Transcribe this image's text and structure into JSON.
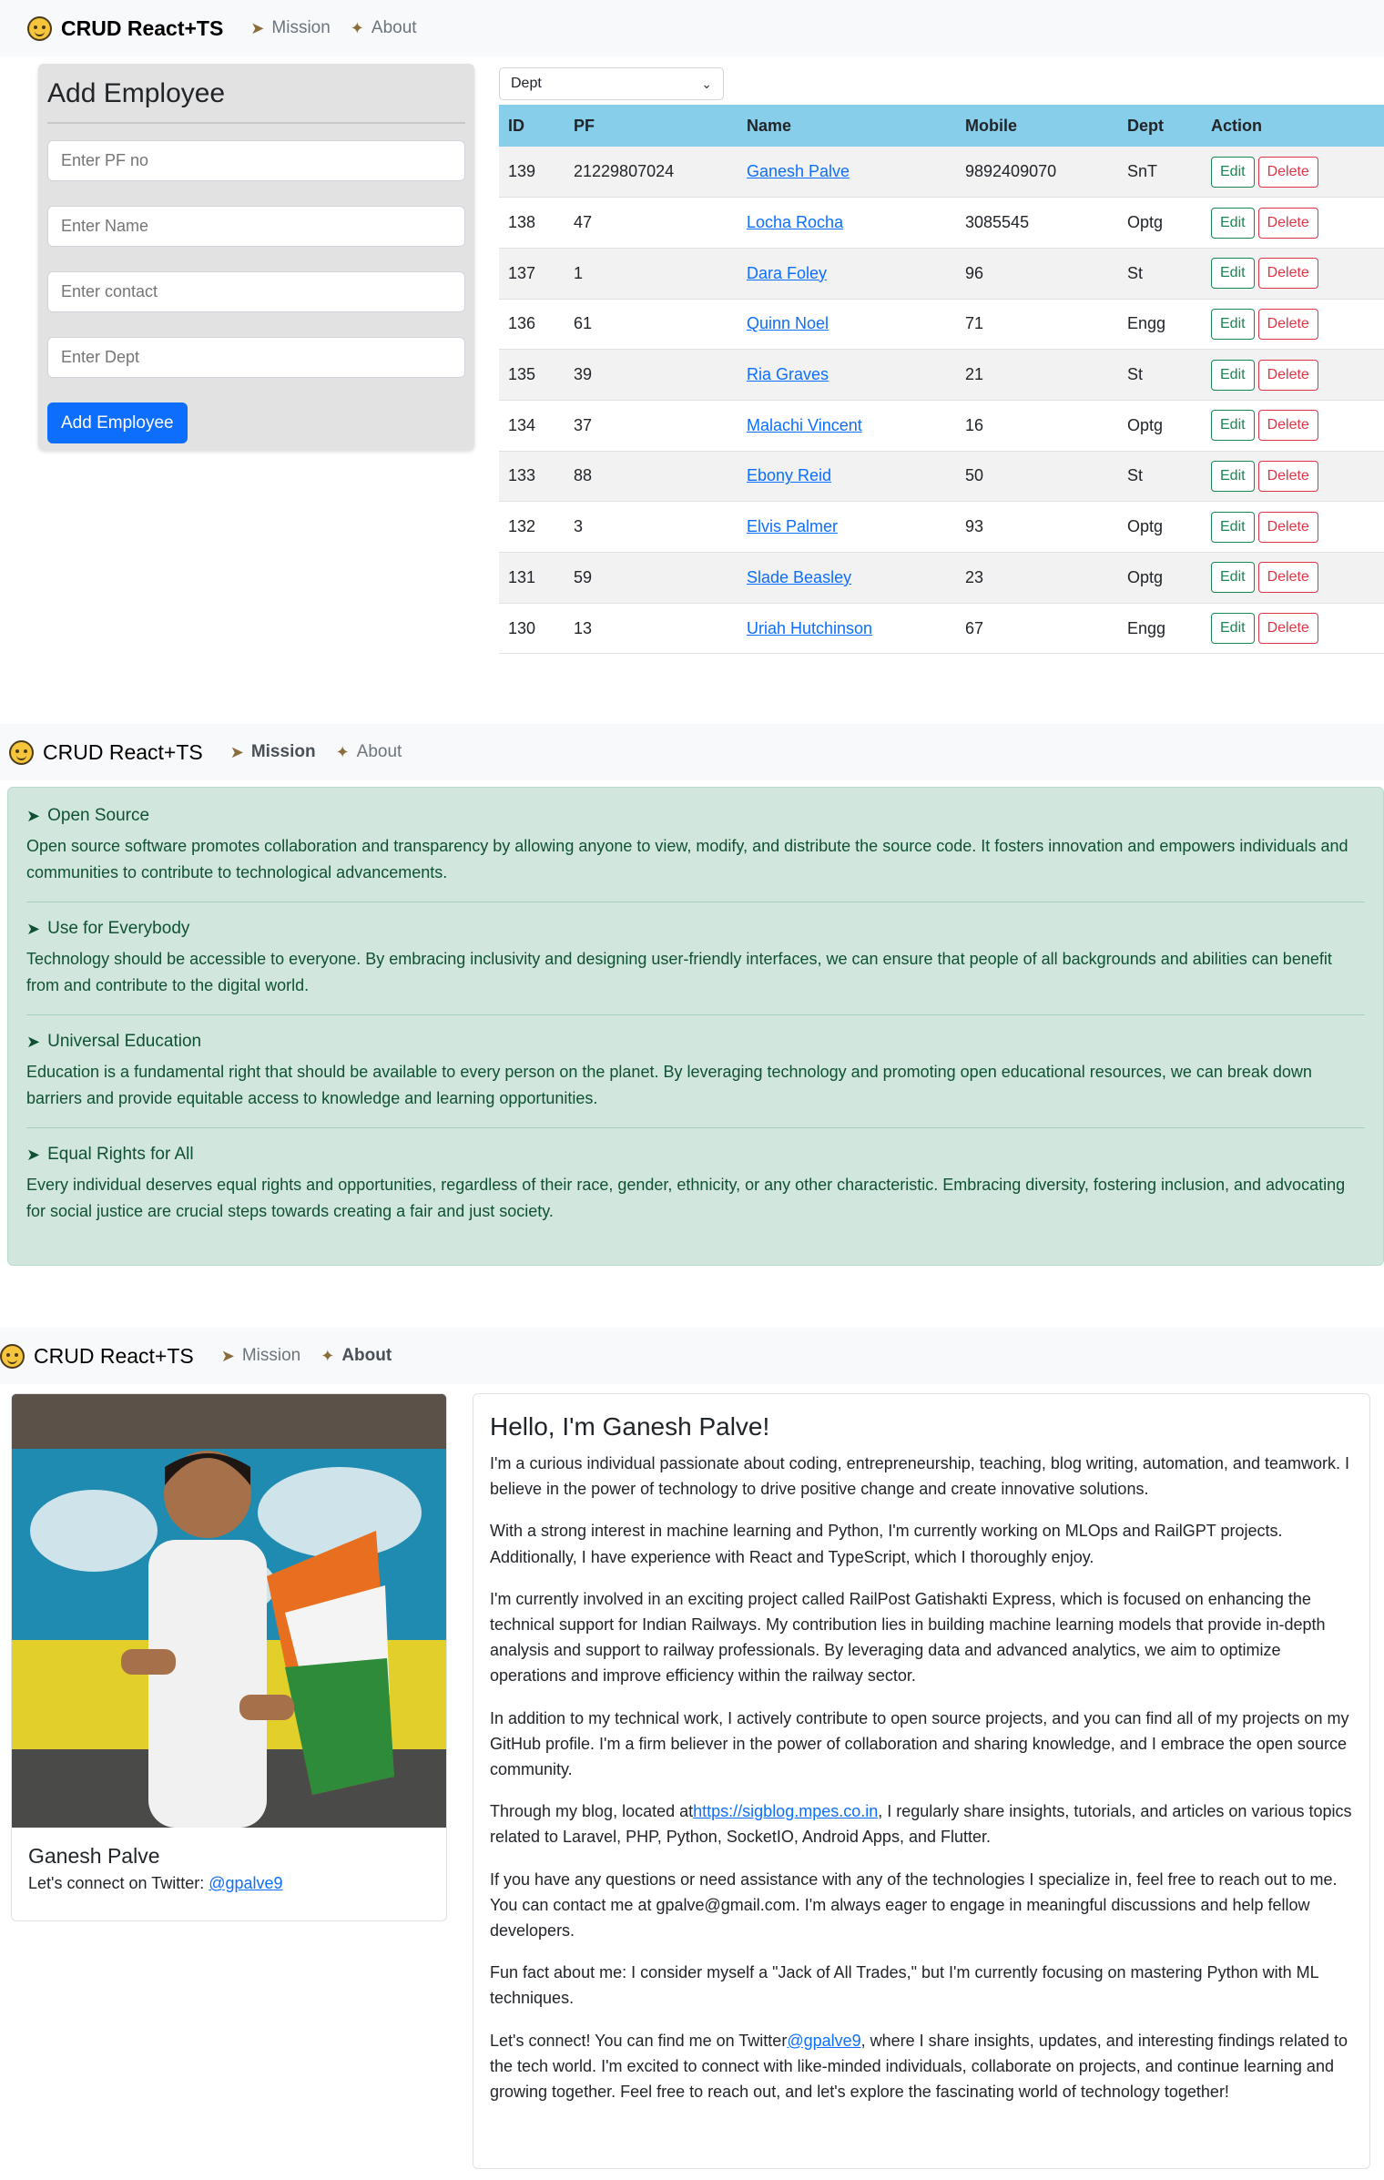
{
  "brand": "CRUD React+TS",
  "nav": {
    "mission": "Mission",
    "about": "About"
  },
  "icons": {
    "brand": "smiley-face-icon",
    "mission": "rocket-icon",
    "about": "sparkle-icon"
  },
  "colors": {
    "accent": "#0d6efd",
    "table_header": "#87ceeb",
    "edit": "#198754",
    "delete": "#dc3545",
    "mission_bg": "#d1e7dd",
    "mission_text": "#0f5132"
  },
  "form": {
    "title": "Add Employee",
    "pf_placeholder": "Enter PF no",
    "name_placeholder": "Enter Name",
    "contact_placeholder": "Enter contact",
    "dept_placeholder": "Enter Dept",
    "submit_label": "Add Employee"
  },
  "filter": {
    "selected": "Dept"
  },
  "table": {
    "headers": [
      "ID",
      "PF",
      "Name",
      "Mobile",
      "Dept",
      "Action"
    ],
    "edit_label": "Edit",
    "delete_label": "Delete",
    "rows": [
      {
        "id": "139",
        "pf": "21229807024",
        "name": "Ganesh Palve",
        "mobile": "9892409070",
        "dept": "SnT"
      },
      {
        "id": "138",
        "pf": "47",
        "name": "Locha Rocha",
        "mobile": "3085545",
        "dept": "Optg"
      },
      {
        "id": "137",
        "pf": "1",
        "name": "Dara Foley",
        "mobile": "96",
        "dept": "St"
      },
      {
        "id": "136",
        "pf": "61",
        "name": "Quinn Noel",
        "mobile": "71",
        "dept": "Engg"
      },
      {
        "id": "135",
        "pf": "39",
        "name": "Ria Graves",
        "mobile": "21",
        "dept": "St"
      },
      {
        "id": "134",
        "pf": "37",
        "name": "Malachi Vincent",
        "mobile": "16",
        "dept": "Optg"
      },
      {
        "id": "133",
        "pf": "88",
        "name": "Ebony Reid",
        "mobile": "50",
        "dept": "St"
      },
      {
        "id": "132",
        "pf": "3",
        "name": "Elvis Palmer",
        "mobile": "93",
        "dept": "Optg"
      },
      {
        "id": "131",
        "pf": "59",
        "name": "Slade Beasley",
        "mobile": "23",
        "dept": "Optg"
      },
      {
        "id": "130",
        "pf": "13",
        "name": "Uriah Hutchinson",
        "mobile": "67",
        "dept": "Engg"
      }
    ]
  },
  "mission": [
    {
      "title": "Open Source",
      "text": "Open source software promotes collaboration and transparency by allowing anyone to view, modify, and distribute the source code. It fosters innovation and empowers individuals and communities to contribute to technological advancements."
    },
    {
      "title": "Use for Everybody",
      "text": "Technology should be accessible to everyone. By embracing inclusivity and designing user-friendly interfaces, we can ensure that people of all backgrounds and abilities can benefit from and contribute to the digital world."
    },
    {
      "title": "Universal Education",
      "text": "Education is a fundamental right that should be available to every person on the planet. By leveraging technology and promoting open educational resources, we can break down barriers and provide equitable access to knowledge and learning opportunities."
    },
    {
      "title": "Equal Rights for All",
      "text": "Every individual deserves equal rights and opportunities, regardless of their race, gender, ethnicity, or any other characteristic. Embracing diversity, fostering inclusion, and advocating for social justice are crucial steps towards creating a fair and just society."
    }
  ],
  "profile": {
    "name": "Ganesh Palve",
    "twitter_prefix": "Let's connect on Twitter: ",
    "twitter_handle": "@gpalve9"
  },
  "about": {
    "heading": "Hello, I'm Ganesh Palve!",
    "p1": "I'm a curious individual passionate about coding, entrepreneurship, teaching, blog writing, automation, and teamwork. I believe in the power of technology to drive positive change and create innovative solutions.",
    "p2": "With a strong interest in machine learning and Python, I'm currently working on MLOps and RailGPT projects. Additionally, I have experience with React and TypeScript, which I thoroughly enjoy.",
    "p3": "I'm currently involved in an exciting project called RailPost Gatishakti Express, which is focused on enhancing the technical support for Indian Railways. My contribution lies in building machine learning models that provide in-depth analysis and support to railway professionals. By leveraging data and advanced analytics, we aim to optimize operations and improve efficiency within the railway sector.",
    "p4": "In addition to my technical work, I actively contribute to open source projects, and you can find all of my projects on my GitHub profile. I'm a firm believer in the power of collaboration and sharing knowledge, and I embrace the open source community.",
    "p5_pre": "Through my blog, located at",
    "p5_link": "https://sigblog.mpes.co.in",
    "p5_post": ", I regularly share insights, tutorials, and articles on various topics related to Laravel, PHP, Python, SocketIO, Android Apps, and Flutter.",
    "p6": "If you have any questions or need assistance with any of the technologies I specialize in, feel free to reach out to me. You can contact me at gpalve@gmail.com. I'm always eager to engage in meaningful discussions and help fellow developers.",
    "p7": "Fun fact about me: I consider myself a \"Jack of All Trades,\" but I'm currently focusing on mastering Python with ML techniques.",
    "p8_pre": "Let's connect! You can find me on Twitter",
    "p8_link": "@gpalve9",
    "p8_post": ", where I share insights, updates, and interesting findings related to the tech world. I'm excited to connect with like-minded individuals, collaborate on projects, and continue learning and growing together. Feel free to reach out, and let's explore the fascinating world of technology together!"
  }
}
